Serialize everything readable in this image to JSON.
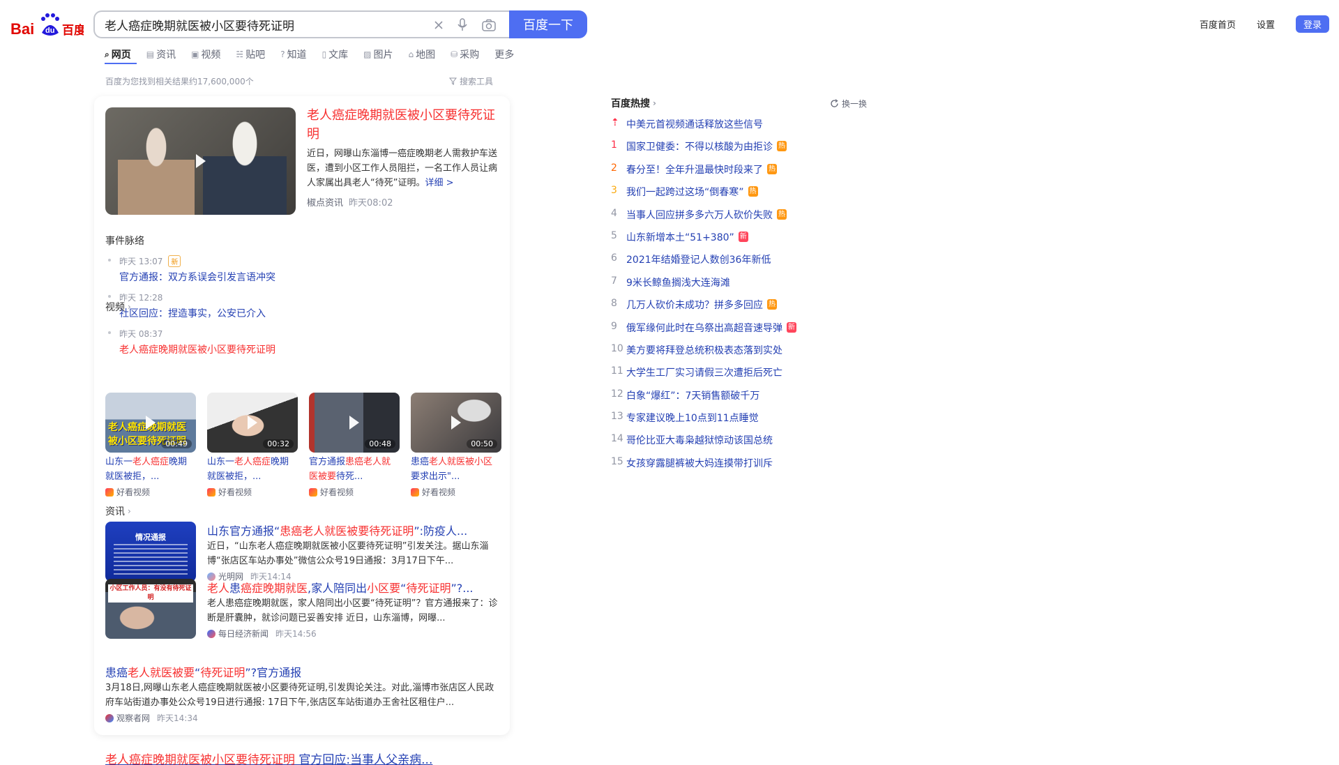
{
  "search": {
    "query": "老人癌症晚期就医被小区要待死证明",
    "button": "百度一下"
  },
  "topnav": {
    "home": "百度首页",
    "settings": "设置",
    "login": "登录"
  },
  "tabs": [
    {
      "label": "网页",
      "icon": "search-icon"
    },
    {
      "label": "资讯",
      "icon": "news-icon"
    },
    {
      "label": "视频",
      "icon": "video-icon"
    },
    {
      "label": "贴吧",
      "icon": "tieba-icon"
    },
    {
      "label": "知道",
      "icon": "question-icon"
    },
    {
      "label": "文库",
      "icon": "doc-icon"
    },
    {
      "label": "图片",
      "icon": "image-icon"
    },
    {
      "label": "地图",
      "icon": "map-icon"
    },
    {
      "label": "采购",
      "icon": "shop-icon"
    },
    {
      "label": "更多",
      "icon": ""
    }
  ],
  "stats": "百度为您找到相关结果约17,600,000个",
  "search_tools": "搜索工具",
  "top_result": {
    "title": "老人癌症晚期就医被小区要待死证明",
    "desc": "近日，网曝山东淄博一癌症晚期老人需救护车送医，遭到小区工作人员阻拦，一名工作人员让病人家属出具老人“待死”证明。",
    "more": "详细 >",
    "source": "椒点资讯",
    "time": "昨天08:02"
  },
  "timeline": {
    "title": "事件脉络",
    "items": [
      {
        "time": "昨天 13:07",
        "badge": "新",
        "text": "官方通报：双方系误会引发言语冲突",
        "red": false
      },
      {
        "time": "昨天 12:28",
        "badge": "",
        "text": "社区回应：捏造事实，公安已介入",
        "red": false
      },
      {
        "time": "昨天 08:37",
        "badge": "",
        "text": "老人癌症晚期就医被小区要待死证明",
        "red": true
      }
    ]
  },
  "videos": {
    "title": "视频",
    "items": [
      {
        "duration": "00:49",
        "pre": "山东一",
        "hl": "老人癌症",
        "post": "晚期就医被拒，...",
        "source": "好看视频",
        "overlay": "老人癌症晚期就医被小区要待死证明"
      },
      {
        "duration": "00:32",
        "pre": "山东一",
        "hl": "老人癌症",
        "post": "晚期就医被拒，...",
        "source": "好看视频"
      },
      {
        "duration": "00:48",
        "pre": "官方通报",
        "hl": "患癌老人就医被要",
        "post": "待死...",
        "source": "好看视频"
      },
      {
        "duration": "00:50",
        "pre": "患癌",
        "hl": "老人就医被小区",
        "post": "要求出示\"...",
        "source": "好看视频"
      }
    ]
  },
  "news": {
    "title": "资讯",
    "items": [
      {
        "title_parts": [
          [
            "山东官方通报“",
            false
          ],
          [
            "患癌老人就医被要待死证明",
            true
          ],
          [
            "”:防疫人...",
            false
          ]
        ],
        "desc": "近日，“山东老人癌症晚期就医被小区要待死证明”引发关注。据山东淄博“张店区车站办事处”微信公众号19日通报：3月17日下午...",
        "source": "光明网",
        "time": "昨天14:14",
        "thumb_title": "情况通报"
      },
      {
        "title_parts": [
          [
            "老人",
            true
          ],
          [
            "患",
            false
          ],
          [
            "癌症晚期就医",
            true
          ],
          [
            ",家人陪同出",
            false
          ],
          [
            "小区要",
            true
          ],
          [
            "“",
            false
          ],
          [
            "待死证明",
            true
          ],
          [
            "”?...",
            false
          ]
        ],
        "desc": "老人患癌症晚期就医，家人陪同出小区要“待死证明”？官方通报来了：诊断是肝囊肿，就诊问题已妥善安排 近日，山东淄博，网曝...",
        "source": "每日经济新闻",
        "time": "昨天14:56",
        "thumb_title": "小区工作人员：有没有待死证明"
      },
      {
        "title_parts": [
          [
            "患癌",
            false
          ],
          [
            "老人就医被要",
            true
          ],
          [
            "“",
            false
          ],
          [
            "待死证明",
            true
          ],
          [
            "”?官方通报",
            false
          ]
        ],
        "desc": "3月18日,网曝山东老人癌症晚期就医被小区要待死证明,引发舆论关注。对此,淄博市张店区人民政府车站街道办事处公众号19日进行通报: 17日下午,张店区车站街道办王舍社区租住户...",
        "source": "观察者网",
        "time": "昨天14:34"
      }
    ]
  },
  "bottom_link": {
    "hl": "老人癌症晚期就医被小区要待死证明",
    "rest": " 官方回应:当事人父亲病..."
  },
  "hot": {
    "title": "百度热搜",
    "refresh": "换一换",
    "items": [
      {
        "rank": "⇡",
        "text": "中美元首视频通话释放这些信号",
        "tag": ""
      },
      {
        "rank": "1",
        "text": "国家卫健委：不得以核酸为由拒诊",
        "tag": "热"
      },
      {
        "rank": "2",
        "text": "春分至！全年升温最快时段来了",
        "tag": "热"
      },
      {
        "rank": "3",
        "text": "我们一起跨过这场“倒春寒”",
        "tag": "热"
      },
      {
        "rank": "4",
        "text": "当事人回应拼多多六万人砍价失败",
        "tag": "热"
      },
      {
        "rank": "5",
        "text": "山东新增本土“51+380”",
        "tag": "新"
      },
      {
        "rank": "6",
        "text": "2021年结婚登记人数创36年新低",
        "tag": ""
      },
      {
        "rank": "7",
        "text": "9米长鲸鱼搁浅大连海滩",
        "tag": ""
      },
      {
        "rank": "8",
        "text": "几万人砍价未成功？拼多多回应",
        "tag": "热"
      },
      {
        "rank": "9",
        "text": "俄军缘何此时在乌祭出高超音速导弹",
        "tag": "新"
      },
      {
        "rank": "10",
        "text": "美方要将拜登总统积极表态落到实处",
        "tag": ""
      },
      {
        "rank": "11",
        "text": "大学生工厂实习请假三次遭拒后死亡",
        "tag": ""
      },
      {
        "rank": "12",
        "text": "白象“爆红”：7天销售额破千万",
        "tag": ""
      },
      {
        "rank": "13",
        "text": "专家建议晚上10点到11点睡觉",
        "tag": ""
      },
      {
        "rank": "14",
        "text": "哥伦比亚大毒枭越狱惊动该国总统",
        "tag": ""
      },
      {
        "rank": "15",
        "text": "女孩穿露腿裤被大妈连摸带打训斥",
        "tag": ""
      }
    ]
  }
}
